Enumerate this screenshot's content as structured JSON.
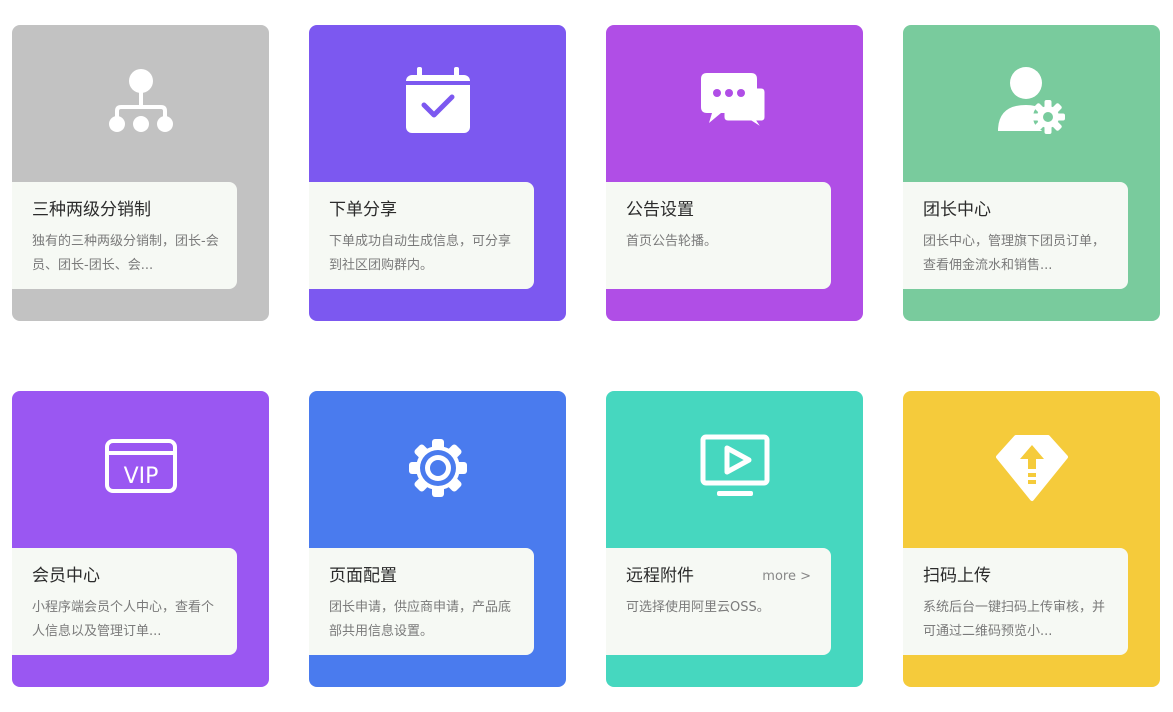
{
  "cards": [
    {
      "title": "三种两级分销制",
      "desc": "独有的三种两级分销制，团长-会员、团长-团长、会...",
      "icon": "hierarchy-icon",
      "color": "#c2c2c2"
    },
    {
      "title": "下单分享",
      "desc": "下单成功自动生成信息，可分享到社区团购群内。",
      "icon": "calendar-check-icon",
      "color": "#7c58f0"
    },
    {
      "title": "公告设置",
      "desc": "首页公告轮播。",
      "icon": "chat-bubbles-icon",
      "color": "#b04ee6"
    },
    {
      "title": "团长中心",
      "desc": "团长中心，管理旗下团员订单，查看佣金流水和销售...",
      "icon": "user-gear-icon",
      "color": "#79cb9d"
    },
    {
      "title": "会员中心",
      "desc": "小程序端会员个人中心，查看个人信息以及管理订单...",
      "icon": "vip-card-icon",
      "color": "#9a57f2",
      "icon_text": "VIP"
    },
    {
      "title": "页面配置",
      "desc": "团长申请，供应商申请，产品底部共用信息设置。",
      "icon": "gear-icon",
      "color": "#4a7bee"
    },
    {
      "title": "远程附件",
      "desc": "可选择使用阿里云OSS。",
      "icon": "monitor-play-icon",
      "color": "#46d7bf",
      "more": "more >"
    },
    {
      "title": "扫码上传",
      "desc": "系统后台一键扫码上传审核，并可通过二维码预览小...",
      "icon": "diamond-upload-icon",
      "color": "#f5cb3b"
    }
  ]
}
